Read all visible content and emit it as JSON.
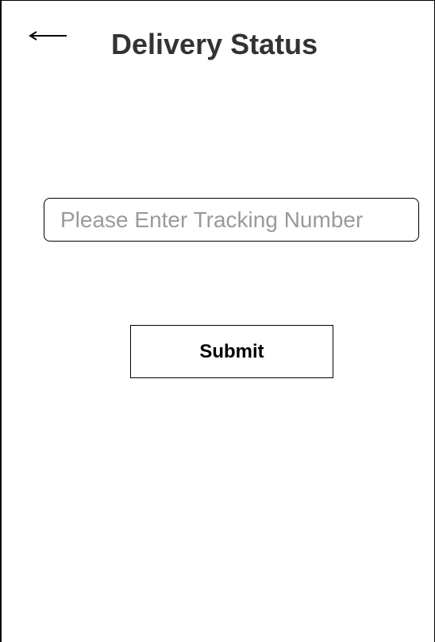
{
  "header": {
    "back_icon": "arrow-left-icon",
    "title": "Delivery Status"
  },
  "form": {
    "tracking_input": {
      "placeholder": "Please Enter Tracking Number",
      "value": ""
    },
    "submit_label": "Submit"
  },
  "colors": {
    "title_text": "#333333",
    "placeholder_text": "#9a9a9a",
    "border": "#000000",
    "background": "#ffffff"
  }
}
